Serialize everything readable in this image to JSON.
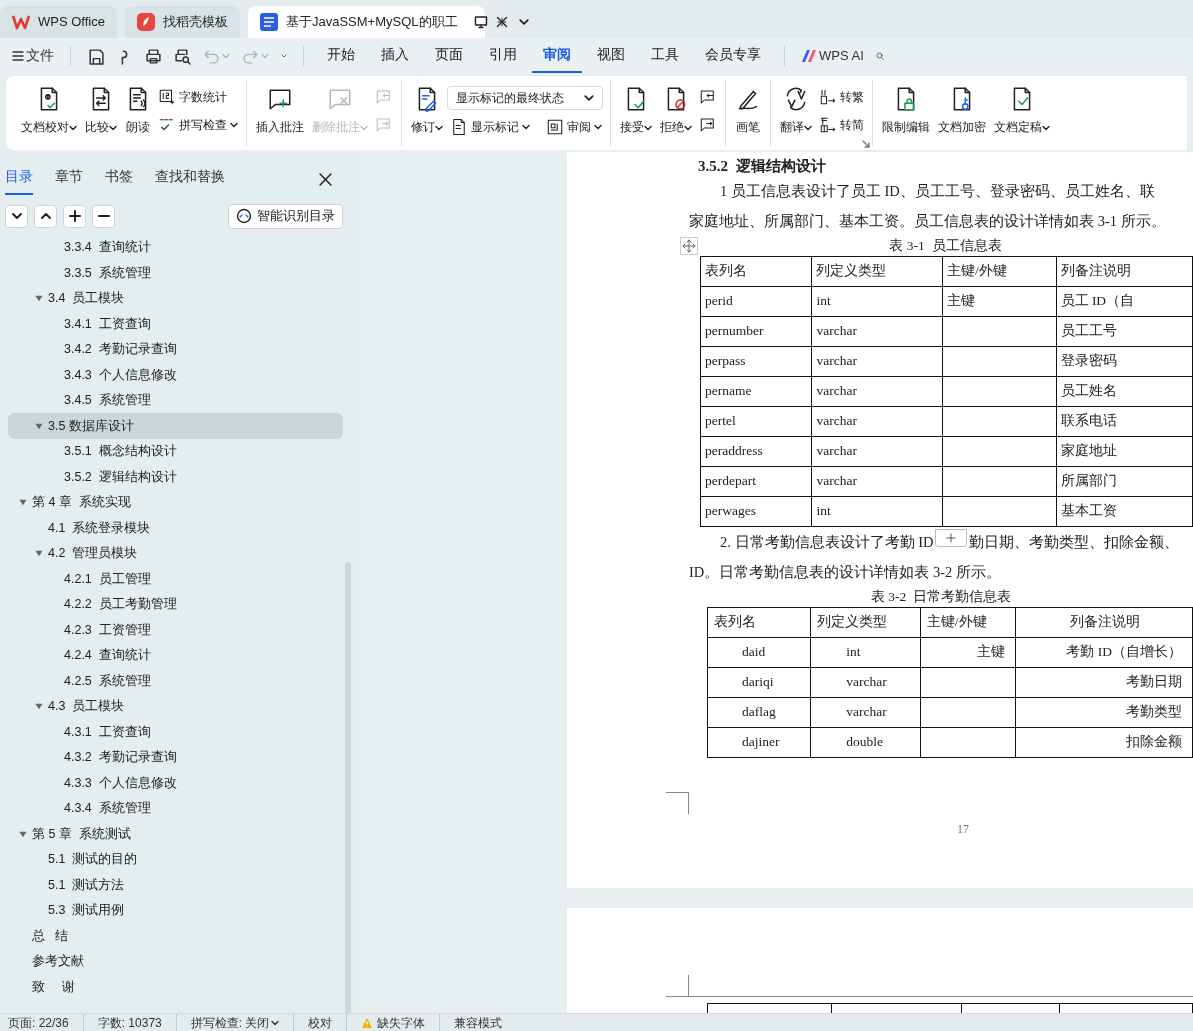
{
  "browser_tabs": [
    {
      "label": "WPS Office",
      "selected": false
    },
    {
      "label": "找稻壳模板",
      "selected": false
    },
    {
      "label": "基于JavaSSM+MySQL的职工",
      "selected": true
    }
  ],
  "menu": {
    "file": "文件",
    "quick_tools": [
      {
        "disabled": false
      },
      {
        "disabled": false
      },
      {
        "disabled": false
      },
      {
        "disabled": false
      },
      {
        "disabled": true
      },
      {
        "disabled": true
      }
    ],
    "tabs": [
      {
        "label": "开始",
        "selected": false
      },
      {
        "label": "插入",
        "selected": false
      },
      {
        "label": "页面",
        "selected": false
      },
      {
        "label": "引用",
        "selected": false
      },
      {
        "label": "审阅",
        "selected": true
      },
      {
        "label": "视图",
        "selected": false
      },
      {
        "label": "工具",
        "selected": false
      },
      {
        "label": "会员专享",
        "selected": false
      }
    ],
    "ai": "WPS AI"
  },
  "ribbon": [
    {
      "columns": [
        {
          "kind": "large",
          "label": "文档校对",
          "dropdown": true,
          "disabled": false
        },
        {
          "kind": "large",
          "label": "比较",
          "dropdown": true,
          "disabled": false
        },
        {
          "kind": "large",
          "label": "朗读",
          "disabled": false
        },
        {
          "kind": "stack",
          "items": [
            {
              "kind": "small",
              "label": "字数统计",
              "disabled": false
            },
            {
              "kind": "small",
              "label": "拼写检查",
              "dropdown": true,
              "disabled": false
            }
          ]
        }
      ]
    },
    {
      "columns": [
        {
          "kind": "large",
          "label": "插入批注",
          "disabled": false
        },
        {
          "kind": "large",
          "label": "删除批注",
          "dropdown": true,
          "disabled": true
        },
        {
          "kind": "stack",
          "items": [
            {
              "kind": "icon",
              "disabled": true
            },
            {
              "kind": "icon",
              "disabled": true
            }
          ]
        }
      ]
    },
    {
      "columns": [
        {
          "kind": "large",
          "label": "修订",
          "dropdown": true,
          "disabled": false
        },
        {
          "kind": "stack",
          "items": [
            {
              "kind": "select",
              "value": "显示标记的最终状态"
            },
            {
              "kind": "row",
              "items": [
                {
                  "kind": "small",
                  "label": "显示标记",
                  "dropdown": true,
                  "disabled": false
                },
                {
                  "kind": "small",
                  "label": "审阅",
                  "dropdown": true,
                  "disabled": false
                }
              ]
            }
          ]
        }
      ]
    },
    {
      "columns": [
        {
          "kind": "large",
          "label": "接受",
          "dropdown": true,
          "disabled": false
        },
        {
          "kind": "large",
          "label": "拒绝",
          "dropdown": true,
          "disabled": false
        },
        {
          "kind": "stack",
          "items": [
            {
              "kind": "icon",
              "disabled": false
            },
            {
              "kind": "icon",
              "disabled": false
            }
          ]
        }
      ]
    },
    {
      "columns": [
        {
          "kind": "large",
          "label": "画笔",
          "disabled": false
        }
      ]
    },
    {
      "launcher": true,
      "columns": [
        {
          "kind": "large",
          "label": "翻译",
          "dropdown": true,
          "disabled": false
        },
        {
          "kind": "stack",
          "items": [
            {
              "kind": "small",
              "label": "转繁",
              "disabled": false
            },
            {
              "kind": "small",
              "label": "转简",
              "disabled": false
            }
          ]
        }
      ]
    },
    {
      "columns": [
        {
          "kind": "large",
          "label": "限制编辑",
          "disabled": false
        },
        {
          "kind": "large",
          "label": "文档加密",
          "disabled": false
        },
        {
          "kind": "large",
          "label": "文档定稿",
          "dropdown": true,
          "disabled": false
        }
      ]
    }
  ],
  "panel": {
    "tabs": [
      {
        "label": "目录",
        "selected": true
      },
      {
        "label": "章节",
        "selected": false
      },
      {
        "label": "书签",
        "selected": false
      },
      {
        "label": "查找和替换",
        "selected": false
      }
    ],
    "smart_button": "智能识别目录",
    "toc": [
      {
        "children": [
          {
            "children": [
              {
                "label": "3.3.4  查询统计",
                "selected": false
              },
              {
                "label": "3.3.5  系统管理",
                "selected": false
              }
            ]
          },
          {
            "label": "3.4  员工模块",
            "expanded": true,
            "selected": false,
            "children": [
              {
                "label": "3.4.1  工资查询",
                "selected": false
              },
              {
                "label": "3.4.2  考勤记录查询",
                "selected": false
              },
              {
                "label": "3.4.3  个人信息修改",
                "selected": false
              },
              {
                "label": "3.4.5  系统管理",
                "selected": false
              }
            ]
          },
          {
            "label": "3.5 数据库设计",
            "expanded": true,
            "selected": true,
            "children": [
              {
                "label": "3.5.1  概念结构设计",
                "selected": false
              },
              {
                "label": "3.5.2  逻辑结构设计",
                "selected": false
              }
            ]
          }
        ]
      },
      {
        "label": "第 4 章  系统实现",
        "expanded": true,
        "selected": false,
        "children": [
          {
            "label": "4.1  系统登录模块",
            "selected": false
          },
          {
            "label": "4.2  管理员模块",
            "expanded": true,
            "selected": false,
            "children": [
              {
                "label": "4.2.1  员工管理",
                "selected": false
              },
              {
                "label": "4.2.2  员工考勤管理",
                "selected": false
              },
              {
                "label": "4.2.3  工资管理",
                "selected": false
              },
              {
                "label": "4.2.4  查询统计",
                "selected": false
              },
              {
                "label": "4.2.5  系统管理",
                "selected": false
              }
            ]
          },
          {
            "label": "4.3  员工模块",
            "expanded": true,
            "selected": false,
            "children": [
              {
                "label": "4.3.1  工资查询",
                "selected": false
              },
              {
                "label": "4.3.2  考勤记录查询",
                "selected": false
              },
              {
                "label": "4.3.3  个人信息修改",
                "selected": false
              },
              {
                "label": "4.3.4  系统管理",
                "selected": false
              }
            ]
          }
        ]
      },
      {
        "label": "第 5 章  系统测试",
        "expanded": true,
        "selected": false,
        "children": [
          {
            "label": "5.1  测试的目的",
            "selected": false
          },
          {
            "label": "5.1  测试方法",
            "selected": false
          },
          {
            "label": "5.3  测试用例",
            "selected": false
          }
        ]
      },
      {
        "label": "总   结",
        "selected": false
      },
      {
        "label": "参考文献",
        "selected": false
      },
      {
        "label": "致     谢",
        "selected": false
      }
    ]
  },
  "document": {
    "heading": "3.5.2  逻辑结构设计",
    "blocks": [
      {
        "kind": "paragraph",
        "lines": [
          [
            "1 员工信息表设计了员工 ID、员工工号、登录密码、员工姓名、联"
          ],
          [
            "家庭地址、所属部门、基本工资。员工信息表的设计详情如表 3-1 所示。"
          ]
        ]
      },
      {
        "kind": "table",
        "caption": "表 3-1  员工信息表",
        "columns": [
          "表列名",
          "列定义类型",
          "主键/外键",
          "列备注说明"
        ],
        "rows": [
          {
            "name": "perid",
            "type": "int",
            "key": "主键",
            "note": "员工 ID（自"
          },
          {
            "name": "pernumber",
            "type": "varchar",
            "note": "员工工号"
          },
          {
            "name": "perpass",
            "type": "varchar",
            "note": "登录密码"
          },
          {
            "name": "pername",
            "type": "varchar",
            "note": "员工姓名"
          },
          {
            "name": "pertel",
            "type": "varchar",
            "note": "联系电话"
          },
          {
            "name": "peraddress",
            "type": "varchar",
            "note": "家庭地址"
          },
          {
            "name": "perdepart",
            "type": "varchar",
            "note": "所属部门"
          },
          {
            "name": "perwages",
            "type": "int",
            "note": "基本工资"
          }
        ]
      },
      {
        "kind": "paragraph",
        "lines": [
          [
            "2. 日常考勤信息表设计了考勤 ID",
            "勤日期、考勤类型、扣除金额、"
          ],
          [
            "ID。日常考勤信息表的设计详情如表 3-2 所示。"
          ]
        ]
      },
      {
        "kind": "table",
        "caption": "表 3-2  日常考勤信息表",
        "columns": [
          "表列名",
          "列定义类型",
          "主键/外键",
          "列备注说明"
        ],
        "rows": [
          {
            "name": "daid",
            "type": "int",
            "key": "主键",
            "note": "考勤 ID（自增长）"
          },
          {
            "name": "dariqi",
            "type": "varchar",
            "note": "考勤日期"
          },
          {
            "name": "daflag",
            "type": "varchar",
            "note": "考勤类型"
          },
          {
            "name": "dajiner",
            "type": "double",
            "note": "扣除金额"
          }
        ]
      }
    ],
    "page_number": "17"
  },
  "status_bar": [
    {
      "text": "页面: 22/36"
    },
    {
      "text": "字数: 10373"
    },
    {
      "text": "拼写检查: 关闭",
      "dropdown": true
    },
    {
      "text": "校对"
    },
    {
      "text": "缺失字体",
      "warning": true
    },
    {
      "text": "兼容模式"
    }
  ]
}
